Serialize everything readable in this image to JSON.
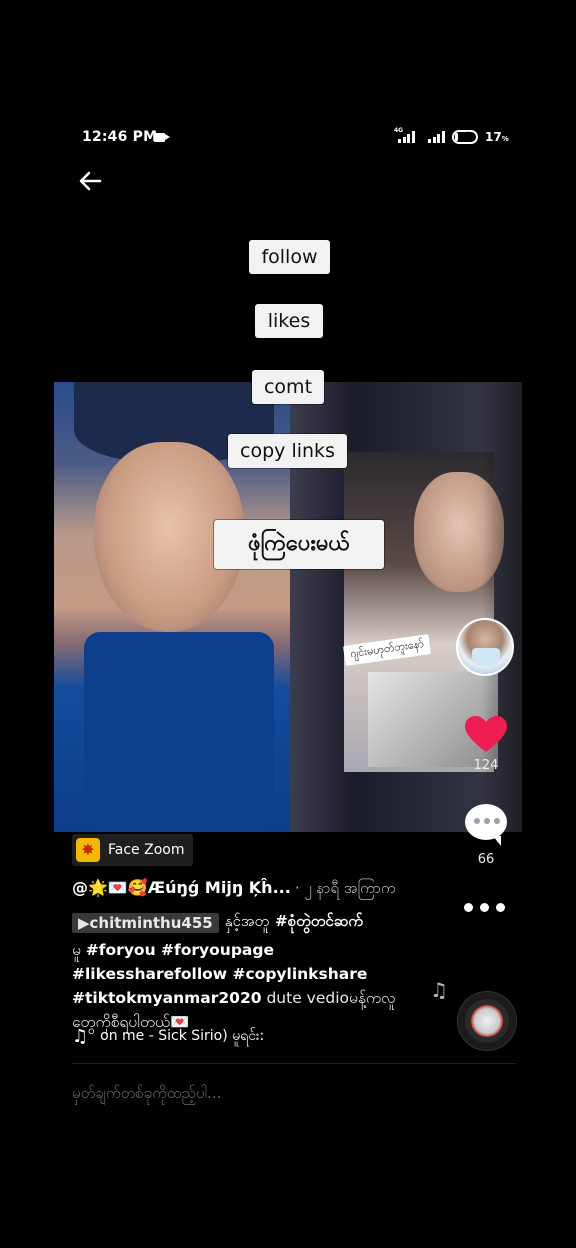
{
  "status_bar": {
    "time": "12:46 PM",
    "network_label": "4G",
    "battery_percent": "17",
    "battery_unit": "%",
    "battery_level": 0.17
  },
  "overlay_chips": [
    "follow",
    "likes",
    "comt",
    "copy links"
  ],
  "overlay_headline": "ဖုံကြဲပေးမယ်",
  "video_sticker": "ဂျင်းမဟုတ်ဘူးနော်",
  "rail": {
    "like_count": "124",
    "comment_count": "66"
  },
  "effect": {
    "label": "Face Zoom"
  },
  "post": {
    "author": "@🌟💌🥰Æúŋǵ Mijŋ Ķĥ...",
    "time_ago": "· ၂ နာရီ အကြာက",
    "mention": "▶chitminthu455",
    "line2_text": "နှင့်အတူ",
    "line2_tag": "#စုံတွဲတင်ဆက်",
    "caption_lead": "မူ",
    "caption_tags": "#foryou #foryoupage #likessharefollow #copylinkshare #tiktokmyanmar2020",
    "caption_tail": "dute vedioမန့်ကလူတွေကိုစီရပါတယ်💌"
  },
  "music": {
    "text": "on me - Sick Sirio)    မူရင်း:"
  },
  "comment_input": {
    "placeholder": "မှတ်ချက်တစ်ခုကိုထည့်ပါ..."
  },
  "colors": {
    "like_heart": "#ee1d52",
    "background": "#000000",
    "chip_bg": "#f2f2f2"
  }
}
